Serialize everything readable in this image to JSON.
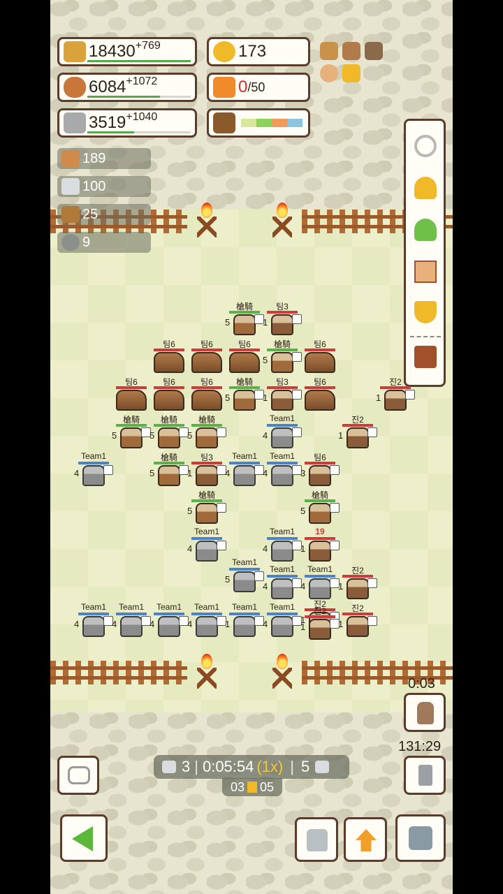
{
  "resources": {
    "wheat": {
      "value": "18430",
      "plus": "+769",
      "icon": "wheat-icon"
    },
    "bread": {
      "value": "6084",
      "plus": "+1072",
      "icon": "bread-icon"
    },
    "stone": {
      "value": "3519",
      "plus": "+1040",
      "icon": "stone-icon"
    },
    "gold": {
      "value": "173",
      "icon": "gold-coin-icon"
    },
    "gift": {
      "value": "0",
      "max": "/50",
      "icon": "gift-icon"
    },
    "plant": {
      "icon": "potted-plant-icon"
    }
  },
  "materials": [
    {
      "icon": "book-icon",
      "value": "189"
    },
    {
      "icon": "metal-block-icon",
      "value": "100"
    },
    {
      "icon": "plank-icon",
      "value": "25"
    },
    {
      "icon": "ore-icon",
      "value": "9"
    }
  ],
  "side_menu": [
    "settings-gear-icon",
    "bell-icon",
    "tree-icon",
    "scroll-icon",
    "trophy-icon",
    "shop-icon"
  ],
  "battle": {
    "countdown": "0:03",
    "clock": "131:29",
    "status": {
      "left_count": "3",
      "time": "0:05:54",
      "speed": "(1x)",
      "right_count": "5",
      "sub_left": "03",
      "sub_right": "05"
    }
  },
  "units": [
    {
      "label": "槍騎",
      "side": "green",
      "level": "5"
    },
    {
      "label": "팀3",
      "side": "red",
      "level": "1"
    },
    {
      "label": "팀6",
      "side": "horse"
    },
    {
      "label": "팀6",
      "side": "horse"
    },
    {
      "label": "팀6",
      "side": "horse"
    },
    {
      "label": "槍騎",
      "side": "green",
      "level": "5"
    },
    {
      "label": "팀6",
      "side": "horse"
    },
    {
      "label": "팀6",
      "side": "horse"
    },
    {
      "label": "팀6",
      "side": "horse"
    },
    {
      "label": "팀6",
      "side": "horse"
    },
    {
      "label": "槍騎",
      "side": "green",
      "level": "5"
    },
    {
      "label": "팀3",
      "side": "red",
      "level": "1"
    },
    {
      "label": "팀6",
      "side": "horse"
    },
    {
      "label": "진2",
      "side": "red",
      "level": "1"
    },
    {
      "label": "槍騎",
      "side": "green",
      "level": "5"
    },
    {
      "label": "槍騎",
      "side": "green",
      "level": "5"
    },
    {
      "label": "槍騎",
      "side": "green",
      "level": "5"
    },
    {
      "label": "Team1",
      "side": "team1",
      "level": "4"
    },
    {
      "label": "진2",
      "side": "red",
      "level": "1"
    },
    {
      "label": "Team1",
      "side": "team1",
      "level": "4"
    },
    {
      "label": "槍騎",
      "side": "green",
      "level": "5"
    },
    {
      "label": "팀3",
      "side": "red",
      "level": "1"
    },
    {
      "label": "Team1",
      "side": "team1",
      "level": "4"
    },
    {
      "label": "Team1",
      "side": "team1",
      "level": "4"
    },
    {
      "label": "팀6",
      "side": "red",
      "level": "3"
    },
    {
      "label": "槍騎",
      "side": "green",
      "level": "5"
    },
    {
      "label": "槍騎",
      "side": "green",
      "level": "5"
    },
    {
      "label": "Team1",
      "side": "team1",
      "level": "4"
    },
    {
      "label": "Team1",
      "side": "team1",
      "level": "4"
    },
    {
      "label": "19",
      "side": "red",
      "level": "1"
    },
    {
      "label": "Team1",
      "side": "team1",
      "level": "5"
    },
    {
      "label": "Team1",
      "side": "team1",
      "level": "4"
    },
    {
      "label": "Team1",
      "side": "team1",
      "level": "4"
    },
    {
      "label": "진2",
      "side": "red",
      "level": "1"
    },
    {
      "label": "진2",
      "side": "red",
      "level": "1"
    },
    {
      "label": "Team1",
      "side": "team1",
      "level": "4"
    },
    {
      "label": "Team1",
      "side": "team1",
      "level": "4"
    },
    {
      "label": "Team1",
      "side": "team1",
      "level": "4"
    },
    {
      "label": "Team1",
      "side": "team1",
      "level": "4"
    },
    {
      "label": "Team1",
      "side": "team1",
      "level": "1"
    },
    {
      "label": "Team1",
      "side": "team1",
      "level": "4"
    },
    {
      "label": "진2",
      "side": "red",
      "level": "1"
    },
    {
      "label": "진2",
      "side": "red",
      "level": "1"
    }
  ],
  "bottom_bar": [
    "back-arrow-icon",
    "armor-icon",
    "rank-up-icon",
    "stone-block-icon"
  ]
}
